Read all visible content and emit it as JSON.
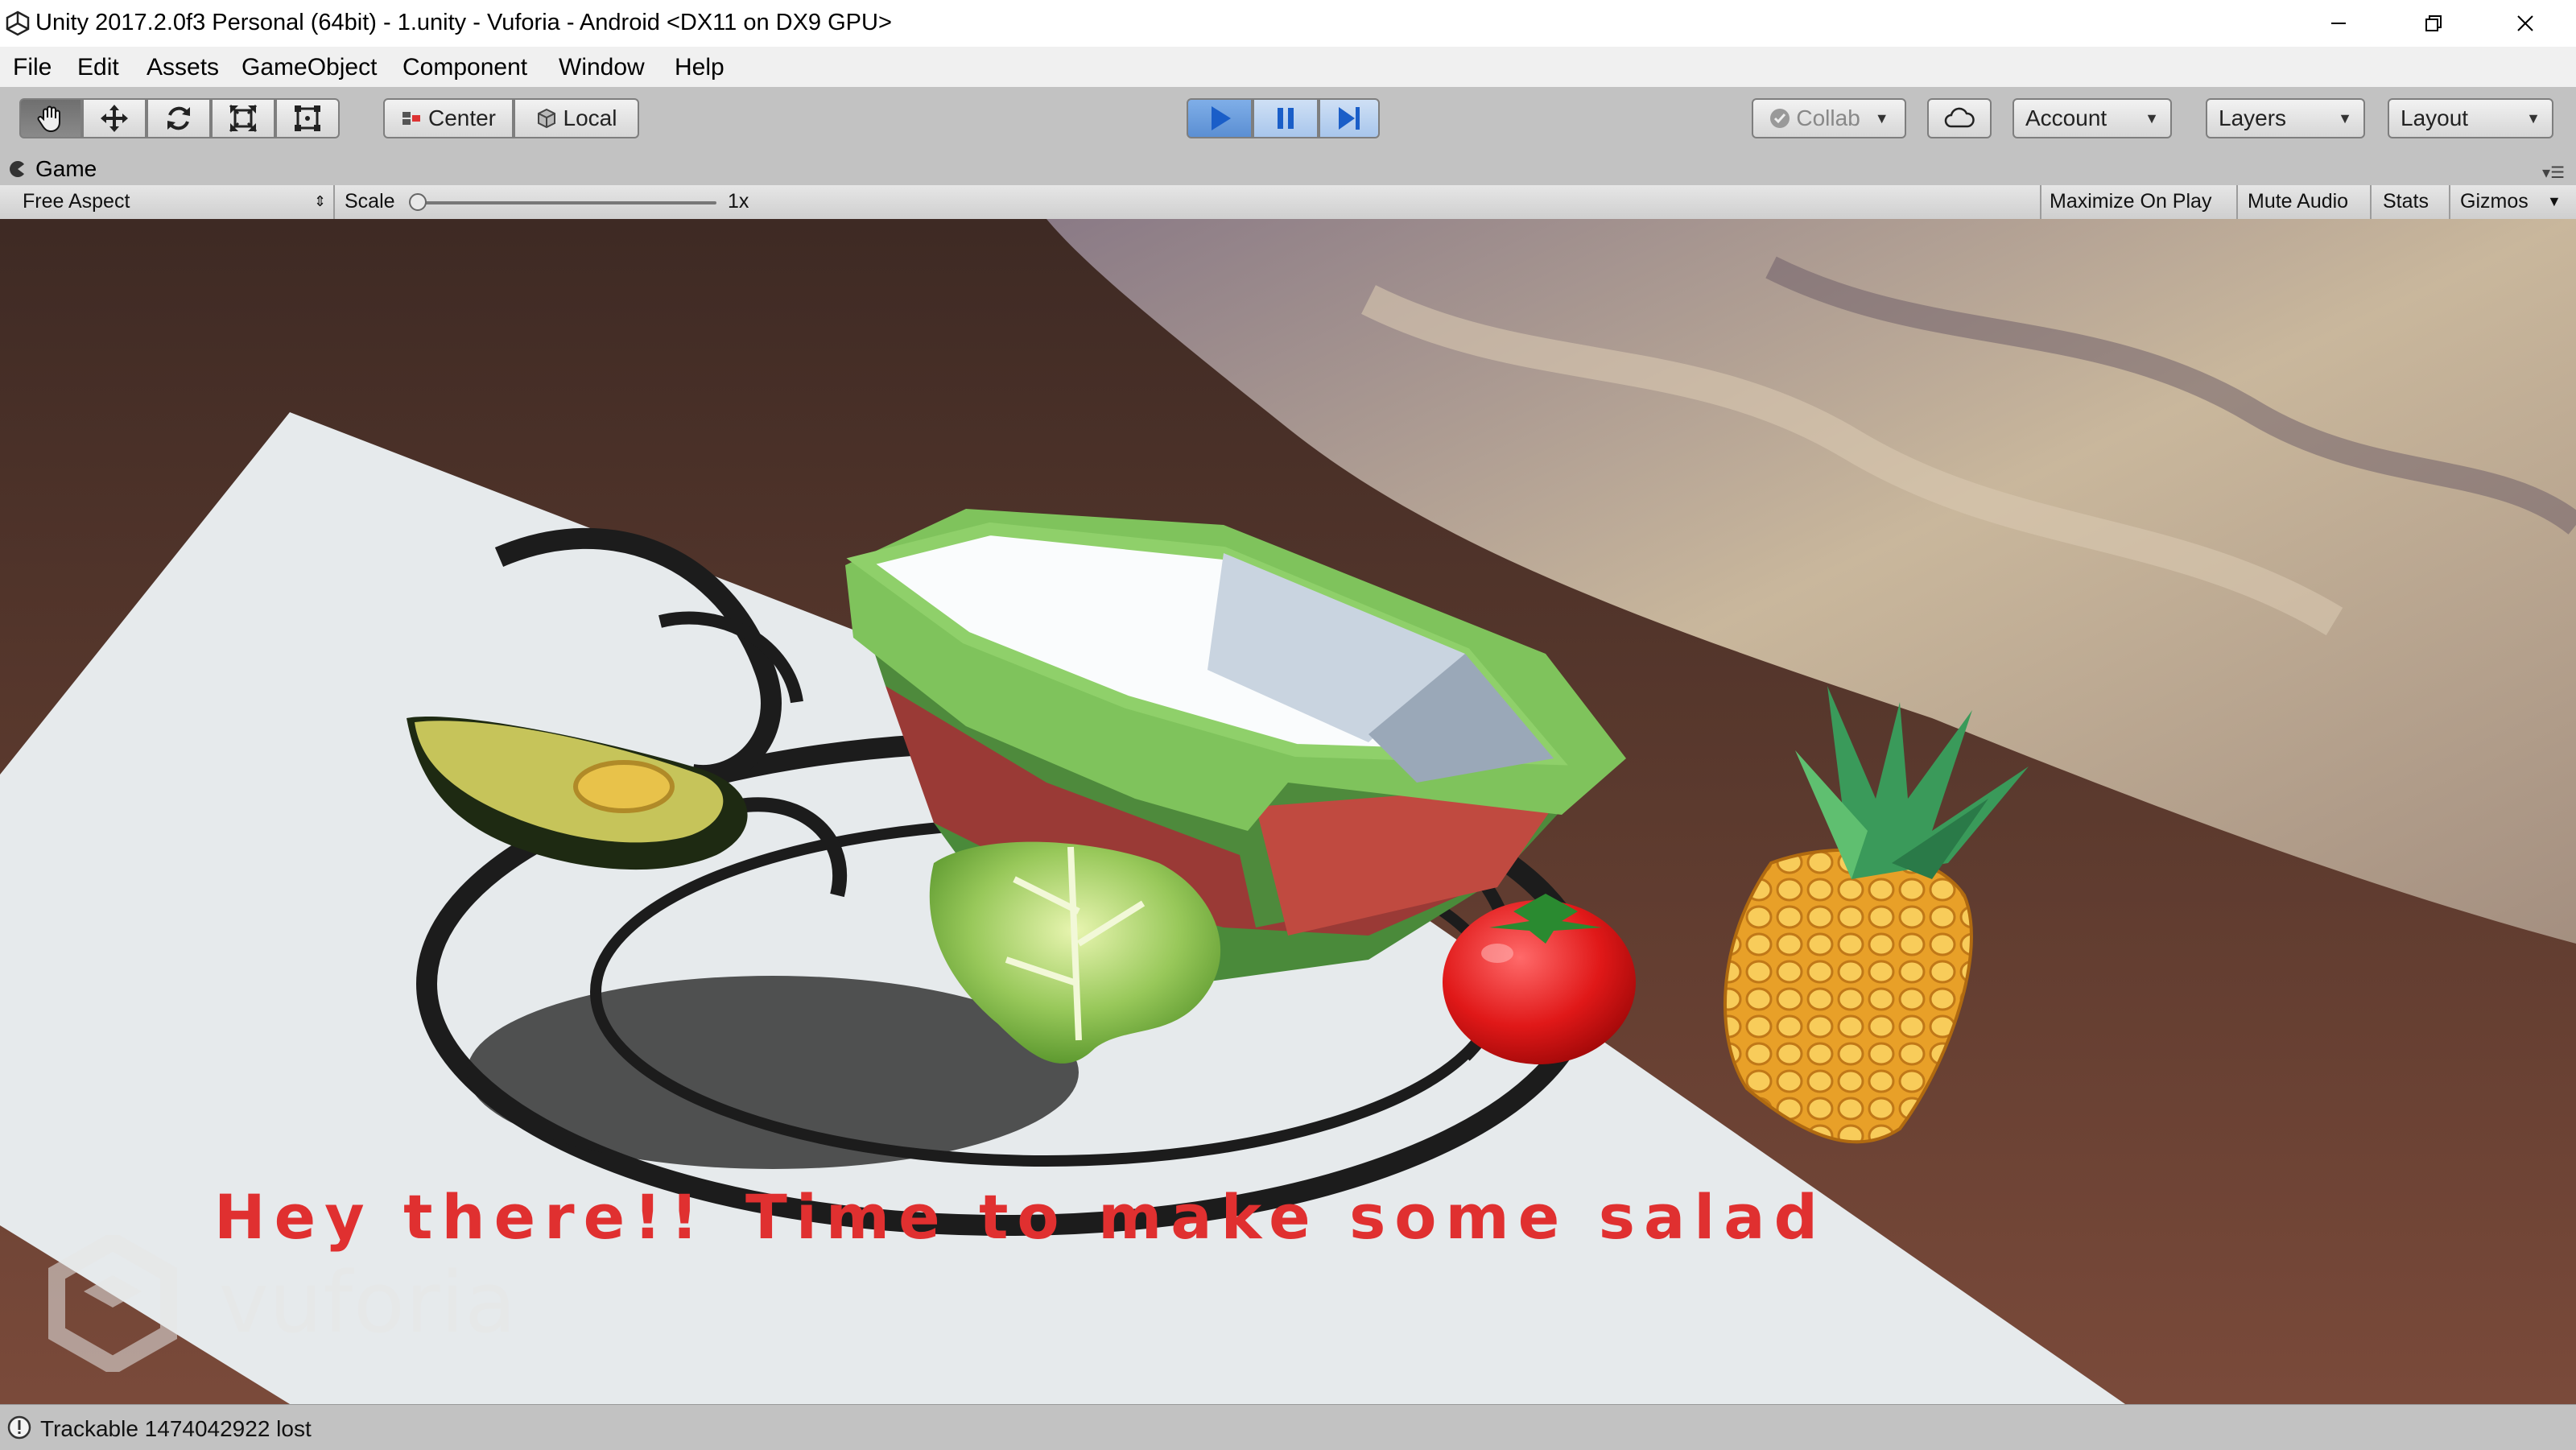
{
  "window": {
    "title": "Unity 2017.2.0f3 Personal (64bit) - 1.unity - Vuforia - Android <DX11 on DX9 GPU>"
  },
  "menu": [
    "File",
    "Edit",
    "Assets",
    "GameObject",
    "Component",
    "Window",
    "Help"
  ],
  "toolbar": {
    "tools": [
      "hand-icon",
      "move-icon",
      "rotate-icon",
      "scale-icon",
      "rect-icon"
    ],
    "active_tool": "hand",
    "pivot_label": "Center",
    "space_label": "Local",
    "play_state": "playing",
    "collab_label": "Collab",
    "account_label": "Account",
    "layers_label": "Layers",
    "layout_label": "Layout"
  },
  "game_view": {
    "tab_label": "Game",
    "aspect_label": "Free Aspect",
    "scale_label": "Scale",
    "scale_value": "1x",
    "maximize_label": "Maximize On Play",
    "mute_label": "Mute Audio",
    "stats_label": "Stats",
    "gizmos_label": "Gizmos",
    "greeting_text": "Hey there!!",
    "message_text": "Time to make some salad",
    "text_color": "#e03030",
    "watermark": "vuforia"
  },
  "status": {
    "message": "Trackable 1474042922 lost"
  }
}
